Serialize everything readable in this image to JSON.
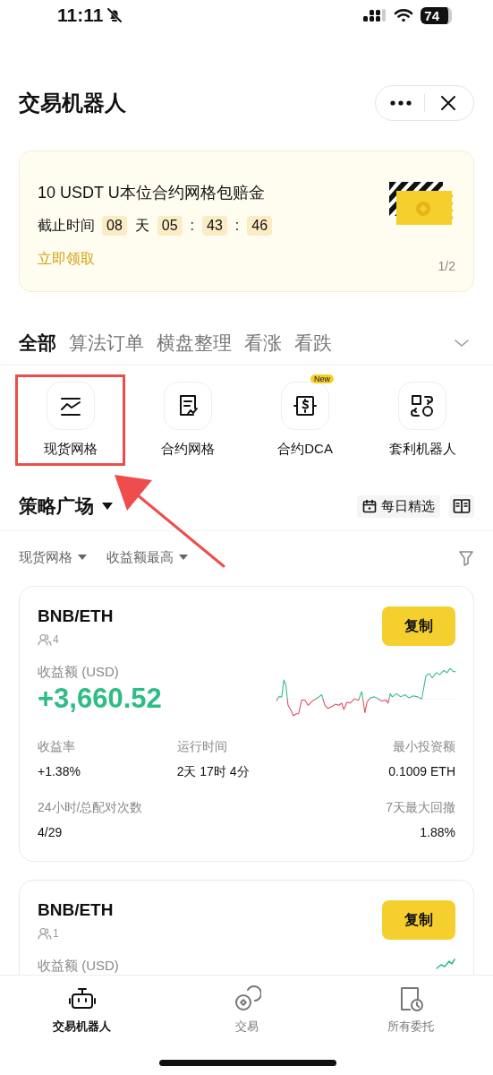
{
  "status_bar": {
    "time": "11:11",
    "battery": "74"
  },
  "header": {
    "title": "交易机器人"
  },
  "banner": {
    "title": "10 USDT U本位合约网格包赔金",
    "deadline_label": "截止时间",
    "countdown": [
      {
        "kind": "box",
        "text": "08"
      },
      {
        "kind": "sep",
        "text": "天"
      },
      {
        "kind": "box",
        "text": "05"
      },
      {
        "kind": "sep",
        "text": ":"
      },
      {
        "kind": "box",
        "text": "43"
      },
      {
        "kind": "sep",
        "text": ":"
      },
      {
        "kind": "box",
        "text": "46"
      }
    ],
    "action": "立即领取",
    "pager": "1/2"
  },
  "tabs": [
    {
      "label": "全部",
      "selected": true
    },
    {
      "label": "算法订单",
      "selected": false
    },
    {
      "label": "横盘整理",
      "selected": false
    },
    {
      "label": "看涨",
      "selected": false
    },
    {
      "label": "看跌",
      "selected": false
    }
  ],
  "categories": [
    {
      "label": "现货网格",
      "kind": "grid",
      "highlighted": true
    },
    {
      "label": "合约网格",
      "kind": "contract",
      "highlighted": false
    },
    {
      "label": "合约DCA",
      "kind": "dca",
      "highlighted": false,
      "badge": "New"
    },
    {
      "label": "套利机器人",
      "kind": "arbitrage",
      "highlighted": false
    }
  ],
  "plaza": {
    "title": "策略广场",
    "daily_pick": "每日精选",
    "filters": [
      "现货网格",
      "收益额最高"
    ]
  },
  "cards": [
    {
      "pair": "BNB/ETH",
      "followers": "4",
      "copy": "复制",
      "profit_label": "收益额 (USD)",
      "profit": "+3,660.52",
      "stat_rows": [
        [
          {
            "label": "收益率",
            "value": "+1.38%"
          },
          {
            "label": "运行时间",
            "value": "2天 17时 4分"
          },
          {
            "label": "最小投资额",
            "value": "0.1009 ETH"
          }
        ],
        [
          {
            "label": "24小时/总配对次数",
            "value": "4/29"
          },
          {
            "label": "7天最大回撤",
            "value": "1.88%"
          }
        ]
      ]
    },
    {
      "pair": "BNB/ETH",
      "followers": "1",
      "copy": "复制",
      "profit_label": "收益额 (USD)"
    }
  ],
  "bottom_nav": [
    {
      "label": "交易机器人",
      "kind": "robot",
      "selected": true
    },
    {
      "label": "交易",
      "kind": "trade",
      "selected": false
    },
    {
      "label": "所有委托",
      "kind": "orders",
      "selected": false
    }
  ]
}
